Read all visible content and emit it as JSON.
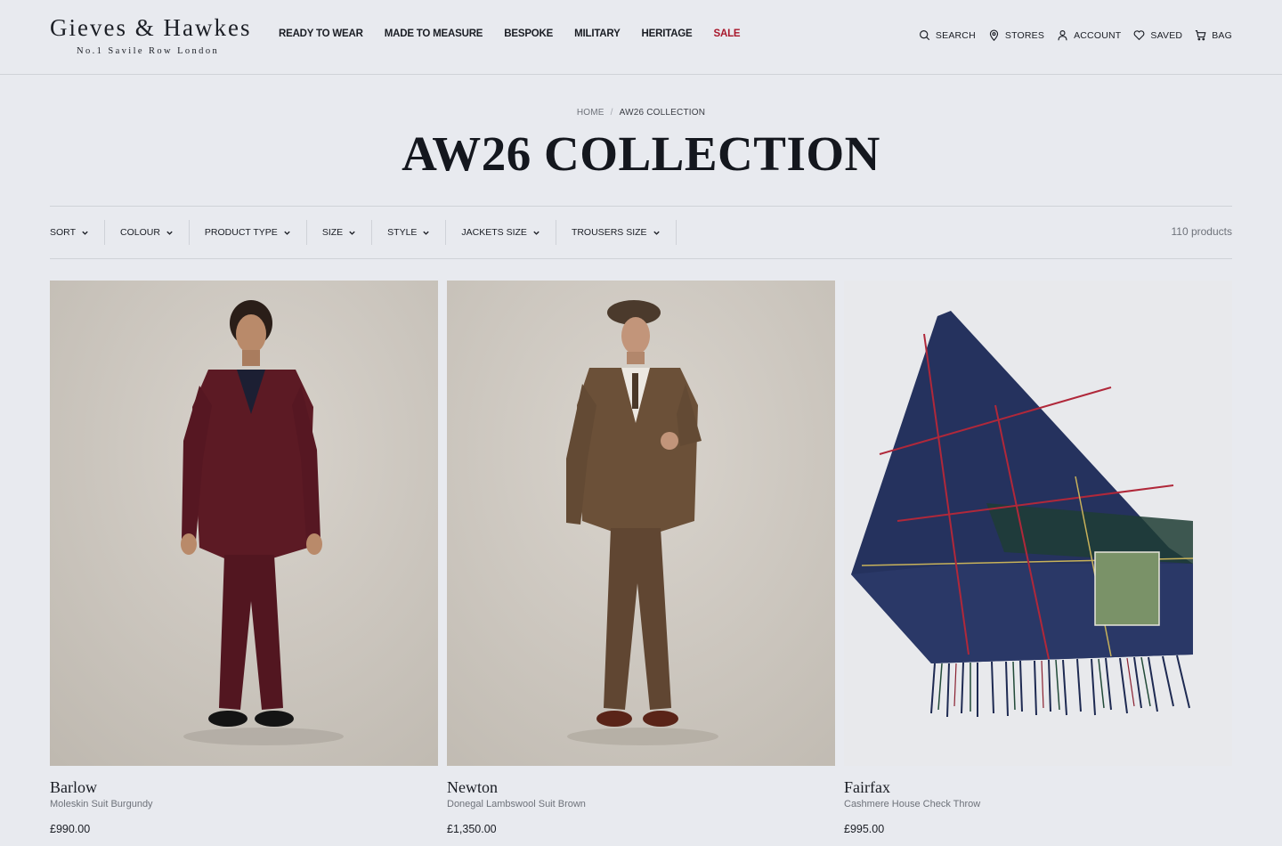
{
  "brand": {
    "name": "Gieves & Hawkes",
    "tagline": "No.1 Savile Row London"
  },
  "nav": {
    "items": [
      {
        "label": "READY TO WEAR"
      },
      {
        "label": "MADE TO MEASURE"
      },
      {
        "label": "BESPOKE"
      },
      {
        "label": "MILITARY"
      },
      {
        "label": "HERITAGE"
      },
      {
        "label": "SALE",
        "color": "#a8172b"
      }
    ]
  },
  "utilities": {
    "search": {
      "label": "SEARCH",
      "icon": "search-icon"
    },
    "stores": {
      "label": "STORES",
      "icon": "location-pin-icon"
    },
    "account": {
      "label": "ACCOUNT",
      "icon": "user-icon"
    },
    "saved": {
      "label": "SAVED",
      "icon": "heart-icon"
    },
    "bag": {
      "label": "BAG",
      "icon": "cart-icon"
    }
  },
  "breadcrumb": {
    "home": "HOME",
    "separator": "/",
    "current": "AW26 COLLECTION"
  },
  "page": {
    "title": "AW26 COLLECTION",
    "background": "#e8eaef"
  },
  "filters": {
    "items": [
      {
        "label": "SORT"
      },
      {
        "label": "COLOUR"
      },
      {
        "label": "PRODUCT TYPE"
      },
      {
        "label": "SIZE"
      },
      {
        "label": "STYLE"
      },
      {
        "label": "JACKETS SIZE"
      },
      {
        "label": "TROUSERS SIZE"
      }
    ],
    "count": "110 products"
  },
  "products": [
    {
      "name": "Barlow",
      "description": "Moleskin Suit Burgundy",
      "price": "£990.00",
      "colour": "#5c1a24"
    },
    {
      "name": "Newton",
      "description": "Donegal Lambswool Suit Brown",
      "price": "£1,350.00",
      "colour": "#6b5038"
    },
    {
      "name": "Fairfax",
      "description": "Cashmere House Check Throw",
      "price": "£995.00",
      "colour": "#25325e"
    }
  ]
}
